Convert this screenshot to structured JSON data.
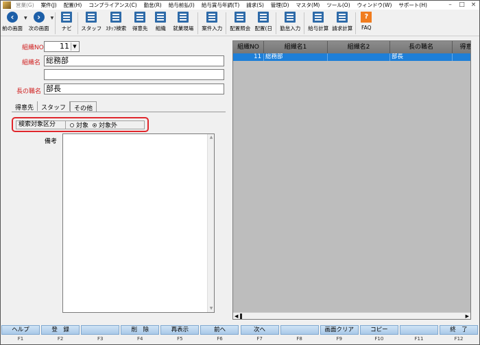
{
  "menubar": {
    "items": [
      "営業(G)",
      "案件(J)",
      "配置(H)",
      "コンプライアンス(C)",
      "勤怠(R)",
      "給与前払(I)",
      "給与賞与年調(T)",
      "請求(S)",
      "管理(D)",
      "マスタ(M)",
      "ツール(O)",
      "ウィンドウ(W)",
      "サポート(H)"
    ],
    "window_controls": [
      "–",
      "□",
      "×"
    ]
  },
  "toolbar": {
    "prev": "前の画面",
    "next": "次の画面",
    "navi": "ナビ",
    "staff": "スタッフ",
    "staff_search": "ｽﾀｯﾌ検索",
    "client": "得意先",
    "org": "組織",
    "worksite": "就業現場",
    "case_entry": "案件入力",
    "assign_inquiry": "配置照会",
    "assign_day": "配置(日",
    "attendance": "勤怠入力",
    "payroll": "給与計算",
    "billing": "請求計算",
    "faq": "FAQ"
  },
  "form": {
    "org_no_label": "組織NO",
    "org_no_value": "11",
    "org_name_label": "組織名",
    "org_name1_value": "総務部",
    "org_name2_value": "",
    "head_title_label": "長の職名",
    "head_title_value": "部長"
  },
  "tabs": [
    "得意先",
    "スタッフ",
    "その他"
  ],
  "search_group": {
    "label": "検索対象区分",
    "option_target": "対象",
    "option_exclude": "対象外",
    "selected": "対象外"
  },
  "memo": {
    "label": "備考",
    "value": ""
  },
  "grid": {
    "columns": [
      "組織NO",
      "組織名1",
      "組織名2",
      "長の職名",
      "得意"
    ],
    "rows": [
      [
        "11",
        "総務部",
        "",
        "部長",
        ""
      ]
    ]
  },
  "fkeys": [
    {
      "label": "ヘルプ",
      "key": "F1"
    },
    {
      "label": "登　録",
      "key": "F2"
    },
    {
      "label": "",
      "key": "F3"
    },
    {
      "label": "削　除",
      "key": "F4"
    },
    {
      "label": "再表示",
      "key": "F5"
    },
    {
      "label": "前へ",
      "key": "F6"
    },
    {
      "label": "次へ",
      "key": "F7"
    },
    {
      "label": "",
      "key": "F8"
    },
    {
      "label": "画面クリア",
      "key": "F9"
    },
    {
      "label": "コピー",
      "key": "F10"
    },
    {
      "label": "",
      "key": "F11"
    },
    {
      "label": "終　了",
      "key": "F12"
    }
  ],
  "colors": {
    "accent_red": "#d02020",
    "highlight_border": "#e0262b",
    "grid_selected": "#1e7fd8",
    "fkey_bg": "#b8d4ee"
  }
}
